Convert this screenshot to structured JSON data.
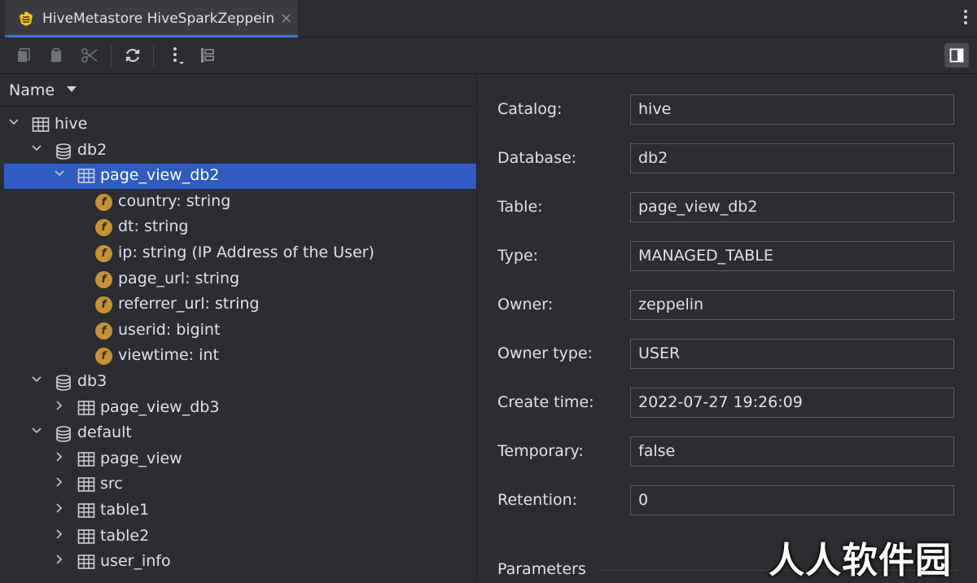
{
  "tab": {
    "title": "HiveMetastore HiveSparkZeppein",
    "close": "×",
    "icon": "hive-bee-icon"
  },
  "toolbar": {
    "buttons": [
      "copy-icon",
      "paste-icon",
      "cut-icon",
      "refresh-icon",
      "more-vertical-icon",
      "hierarchy-icon"
    ],
    "panel_toggle": "panel-toggle-icon"
  },
  "tree": {
    "header": "Name",
    "nodes": [
      {
        "label": "hive",
        "type": "catalog",
        "level": 0,
        "expanded": true
      },
      {
        "label": "db2",
        "type": "database",
        "level": 1,
        "expanded": true
      },
      {
        "label": "page_view_db2",
        "type": "table",
        "level": 2,
        "expanded": true,
        "selected": true
      },
      {
        "label": "country: string",
        "type": "column",
        "level": 3
      },
      {
        "label": "dt: string",
        "type": "column",
        "level": 3
      },
      {
        "label": "ip: string (IP Address of the User)",
        "type": "column",
        "level": 3
      },
      {
        "label": "page_url: string",
        "type": "column",
        "level": 3
      },
      {
        "label": "referrer_url: string",
        "type": "column",
        "level": 3
      },
      {
        "label": "userid: bigint",
        "type": "column",
        "level": 3
      },
      {
        "label": "viewtime: int",
        "type": "column",
        "level": 3
      },
      {
        "label": "db3",
        "type": "database",
        "level": 1,
        "expanded": true
      },
      {
        "label": "page_view_db3",
        "type": "table",
        "level": 2,
        "expanded": false
      },
      {
        "label": "default",
        "type": "database",
        "level": 1,
        "expanded": true
      },
      {
        "label": "page_view",
        "type": "table",
        "level": 2,
        "expanded": false
      },
      {
        "label": "src",
        "type": "table",
        "level": 2,
        "expanded": false
      },
      {
        "label": "table1",
        "type": "table",
        "level": 2,
        "expanded": false
      },
      {
        "label": "table2",
        "type": "table",
        "level": 2,
        "expanded": false
      },
      {
        "label": "user_info",
        "type": "table",
        "level": 2,
        "expanded": false
      }
    ],
    "column_icon_letter": "f"
  },
  "properties": {
    "fields": [
      {
        "label": "Catalog:",
        "value": "hive"
      },
      {
        "label": "Database:",
        "value": "db2"
      },
      {
        "label": "Table:",
        "value": "page_view_db2"
      },
      {
        "label": "Type:",
        "value": "MANAGED_TABLE"
      },
      {
        "label": "Owner:",
        "value": "zeppelin"
      },
      {
        "label": "Owner type:",
        "value": "USER"
      },
      {
        "label": "Create time:",
        "value": "2022-07-27 19:26:09"
      },
      {
        "label": "Temporary:",
        "value": "false"
      },
      {
        "label": "Retention:",
        "value": "0"
      }
    ],
    "section": "Parameters"
  },
  "watermark": "人人软件园",
  "colors": {
    "background": "#2b2d30",
    "selection": "#2e5cc2",
    "tab_accent": "#3574f0",
    "column_icon": "#c7922f"
  }
}
